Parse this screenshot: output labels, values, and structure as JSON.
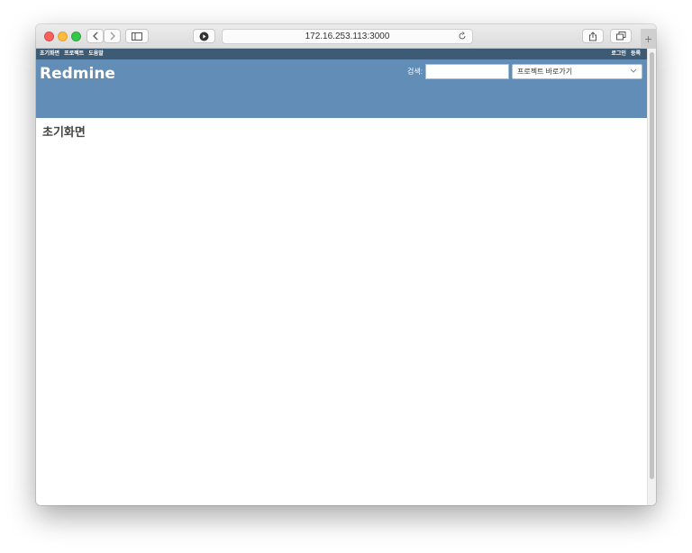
{
  "browser": {
    "url": "172.16.253.113:3000"
  },
  "top_menu": {
    "left_items": [
      "초기화면",
      "프로젝트",
      "도움말"
    ],
    "login_label": "로그인",
    "register_label": "등록"
  },
  "header": {
    "site_title": "Redmine",
    "search_label": "검색:",
    "search_value": "",
    "project_jump_label": "프로젝트 바로가기",
    "background_color": "#628db6",
    "top_menu_color": "#3e5b76"
  },
  "content": {
    "page_title": "초기화면"
  }
}
